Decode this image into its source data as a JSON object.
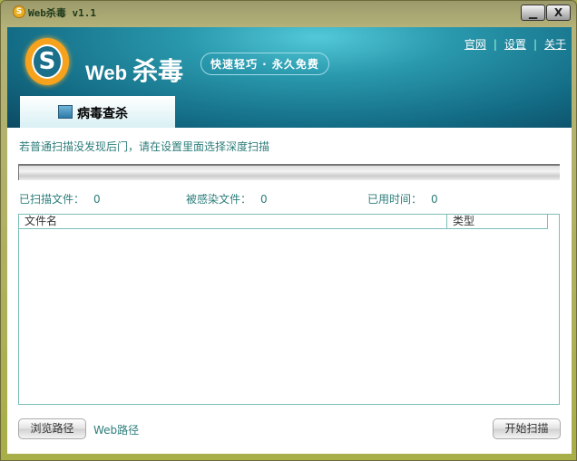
{
  "window": {
    "title": "Web杀毒 v1.1",
    "minimize": "▁",
    "close": "X"
  },
  "header": {
    "logo_letter": "S",
    "brand_prefix": "Web",
    "brand_main": "杀毒",
    "slogan": "快速轻巧 · 永久免费",
    "links": [
      "官网",
      "设置",
      "关于"
    ],
    "tab": "病毒查杀"
  },
  "main": {
    "hint": "若普通扫描没发现后门，请在设置里面选择深度扫描",
    "progress": 0,
    "stats": [
      {
        "label": "已扫描文件：",
        "value": "0"
      },
      {
        "label": "被感染文件：",
        "value": "0"
      },
      {
        "label": "已用时间：",
        "value": "0"
      }
    ],
    "columns": [
      "文件名",
      "类型"
    ],
    "browse_button": "浏览路径",
    "path_label": "Web路径",
    "start_button": "开始扫描"
  }
}
